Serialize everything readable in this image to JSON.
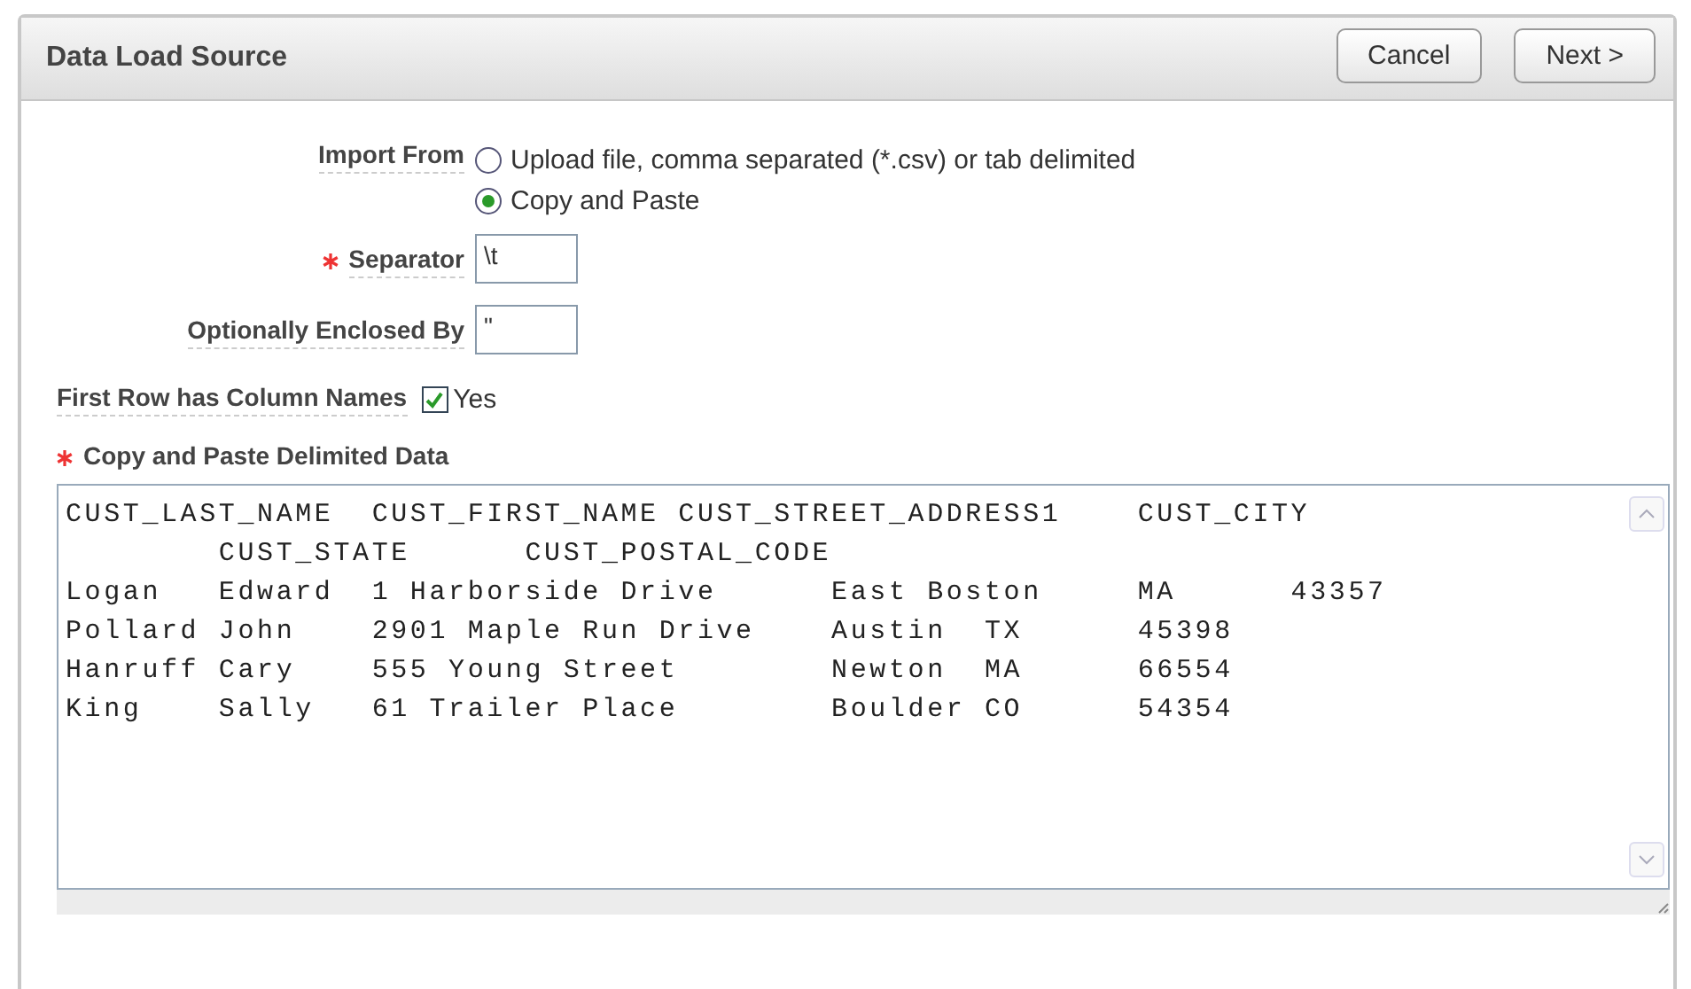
{
  "region": {
    "title": "Data Load Source",
    "buttons": [
      "Cancel",
      "Next >"
    ]
  },
  "import_from": {
    "label": "Import From",
    "options": [
      {
        "label": "Upload file, comma separated (*.csv) or tab delimited",
        "selected": false
      },
      {
        "label": "Copy and Paste",
        "selected": true
      }
    ]
  },
  "separator": {
    "label": "Separator",
    "required": true,
    "value": "\\t"
  },
  "enclosed_by": {
    "label": "Optionally Enclosed By",
    "required": false,
    "value": "\""
  },
  "first_row": {
    "label": "First Row has Column Names",
    "option": "Yes",
    "checked": true
  },
  "data": {
    "label": "Copy and Paste Delimited Data",
    "required": true,
    "lines": [
      "CUST_LAST_NAME  CUST_FIRST_NAME CUST_STREET_ADDRESS1    CUST_CITY",
      "        CUST_STATE      CUST_POSTAL_CODE",
      "Logan   Edward  1 Harborside Drive      East Boston     MA      43357",
      "Pollard John    2901 Maple Run Drive    Austin  TX      45398",
      "Hanruff Cary    555 Young Street        Newton  MA      66554",
      "King    Sally   61 Trailer Place        Boulder CO      54354"
    ]
  }
}
